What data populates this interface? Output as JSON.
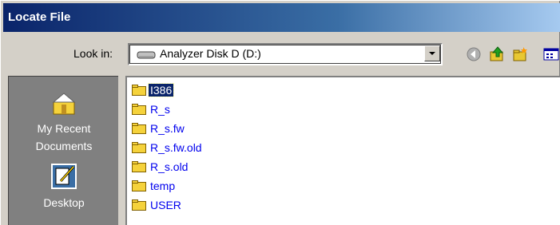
{
  "window": {
    "title": "Locate File"
  },
  "lookin": {
    "label": "Look in:",
    "value": "Analyzer Disk D (D:)",
    "icon": "drive-icon"
  },
  "toolbar": {
    "back": "back-icon",
    "up": "up-folder-icon",
    "new_folder": "new-folder-icon",
    "view": "view-menu-icon"
  },
  "places": [
    {
      "label_line1": "My Recent",
      "label_line2": "Documents",
      "icon": "recent-documents-icon"
    },
    {
      "label_line1": "Desktop",
      "label_line2": "",
      "icon": "desktop-icon"
    }
  ],
  "files": [
    {
      "name": "I386",
      "selected": true
    },
    {
      "name": "R_s"
    },
    {
      "name": "R_s.fw"
    },
    {
      "name": "R_s.fw.old"
    },
    {
      "name": "R_s.old"
    },
    {
      "name": "temp"
    },
    {
      "name": "USER"
    }
  ],
  "colors": {
    "title_start": "#0a246a",
    "title_end": "#a6caf0",
    "dialog": "#d4d0c8",
    "places_bg": "#808080",
    "link": "#0000ee",
    "folder": "#f5d23b"
  }
}
